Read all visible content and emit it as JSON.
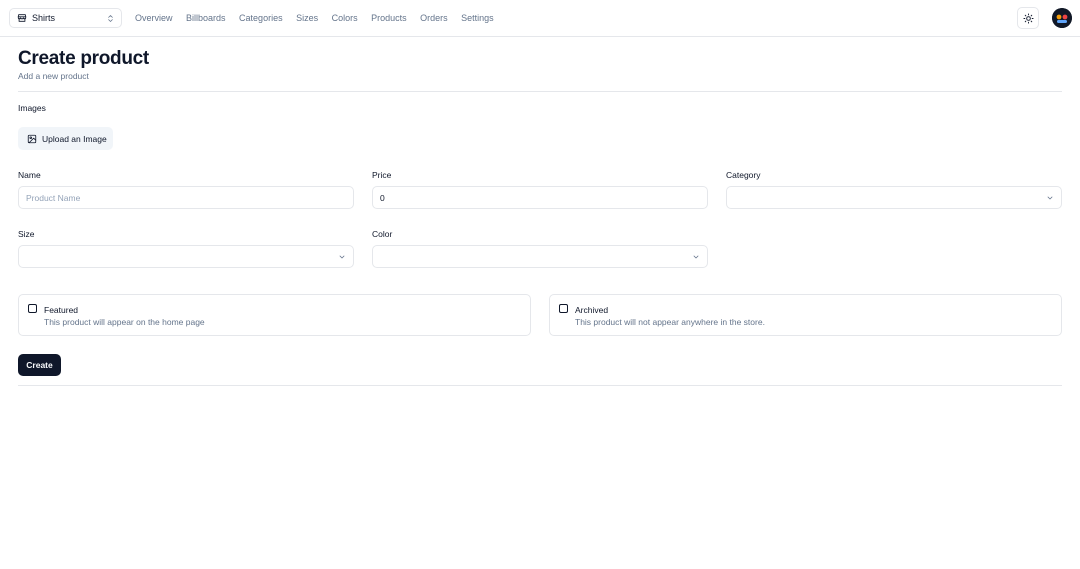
{
  "header": {
    "store_switcher": {
      "value": "Shirts",
      "icon": "store-icon"
    },
    "nav": [
      {
        "label": "Overview"
      },
      {
        "label": "Billboards"
      },
      {
        "label": "Categories"
      },
      {
        "label": "Sizes"
      },
      {
        "label": "Colors"
      },
      {
        "label": "Products"
      },
      {
        "label": "Orders"
      },
      {
        "label": "Settings"
      }
    ],
    "theme_toggle_icon": "sun-icon",
    "avatar_icon": "user-avatar"
  },
  "page": {
    "title": "Create product",
    "description": "Add a new product"
  },
  "form": {
    "images": {
      "label": "Images",
      "upload_label": "Upload an Image"
    },
    "name": {
      "label": "Name",
      "placeholder": "Product Name",
      "value": ""
    },
    "price": {
      "label": "Price",
      "value": "0"
    },
    "category": {
      "label": "Category",
      "value": ""
    },
    "size": {
      "label": "Size",
      "value": ""
    },
    "color": {
      "label": "Color",
      "value": ""
    },
    "featured": {
      "title": "Featured",
      "description": "This product will appear on the home page",
      "checked": false
    },
    "archived": {
      "title": "Archived",
      "description": "This product will not appear anywhere in the store.",
      "checked": false
    },
    "submit_label": "Create"
  },
  "colors": {
    "primary": "#0f172a",
    "muted_text": "#64748b",
    "border": "#e5e7eb",
    "secondary_bg": "#f1f5f9"
  }
}
